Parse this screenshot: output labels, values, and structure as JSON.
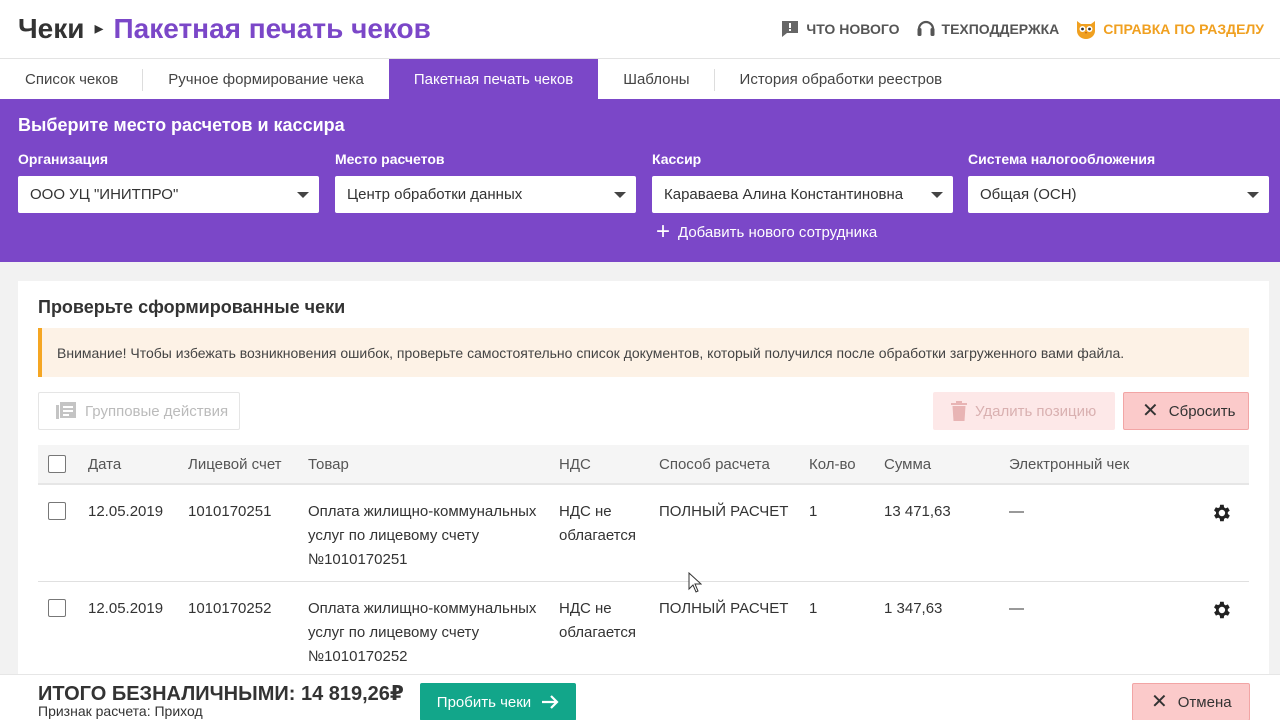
{
  "header": {
    "breadcrumb_root": "Чеки",
    "page_title": "Пакетная печать чеков",
    "links": {
      "whats_new": "Что нового",
      "support": "Техподдержка",
      "help": "Справка по разделу"
    }
  },
  "tabs": [
    {
      "label": "Список чеков",
      "active": false
    },
    {
      "label": "Ручное формирование чека",
      "active": false
    },
    {
      "label": "Пакетная печать чеков",
      "active": true
    },
    {
      "label": "Шаблоны",
      "active": false
    },
    {
      "label": "История обработки реестров",
      "active": false
    }
  ],
  "selection": {
    "title": "Выберите место расчетов и кассира",
    "organization": {
      "label": "Организация",
      "value": "ООО УЦ \"ИНИТПРО\""
    },
    "place": {
      "label": "Место расчетов",
      "value": "Центр обработки данных"
    },
    "cashier": {
      "label": "Кассир",
      "value": "Караваева Алина Константиновна"
    },
    "tax": {
      "label": "Система налогообложения",
      "value": "Общая (ОСН)"
    },
    "add_employee": "Добавить нового сотрудника"
  },
  "review": {
    "title": "Проверьте сформированные чеки",
    "alert": "Внимание! Чтобы избежать возникновения ошибок, проверьте самостоятельно список документов, который получился после обработки загруженного вами файла.",
    "group_actions": "Групповые действия",
    "delete_position": "Удалить позицию",
    "reset": "Сбросить"
  },
  "table": {
    "columns": {
      "date": "Дата",
      "account": "Лицевой счет",
      "product": "Товар",
      "vat": "НДС",
      "payment_method": "Способ расчета",
      "qty": "Кол-во",
      "sum": "Сумма",
      "e_receipt": "Электронный чек"
    },
    "rows": [
      {
        "date": "12.05.2019",
        "account": "1010170251",
        "product_l1": "Оплата жилищно-коммунальных",
        "product_l2": "услуг по лицевому счету",
        "product_l3": "№1010170251",
        "vat_l1": "НДС не",
        "vat_l2": "облагается",
        "payment_method": "ПОЛНЫЙ РАСЧЕТ",
        "qty": "1",
        "sum": "13 471,63",
        "e_receipt": "—"
      },
      {
        "date": "12.05.2019",
        "account": "1010170252",
        "product_l1": "Оплата жилищно-коммунальных",
        "product_l2": "услуг по лицевому счету",
        "product_l3": "№1010170252",
        "vat_l1": "НДС не",
        "vat_l2": "облагается",
        "payment_method": "ПОЛНЫЙ РАСЧЕТ",
        "qty": "1",
        "sum": "1 347,63",
        "e_receipt": "—"
      }
    ]
  },
  "footer": {
    "total": "ИТОГО БЕЗНАЛИЧНЫМИ: 14 819,26₽",
    "sign": "Признак расчета: Приход",
    "print_button": "Пробить чеки",
    "cancel_button": "Отмена"
  },
  "colors": {
    "brand_purple": "#7b47c8",
    "help_orange": "#f0a020",
    "print_green": "#12a68a",
    "danger_pink": "#fbcaca"
  }
}
